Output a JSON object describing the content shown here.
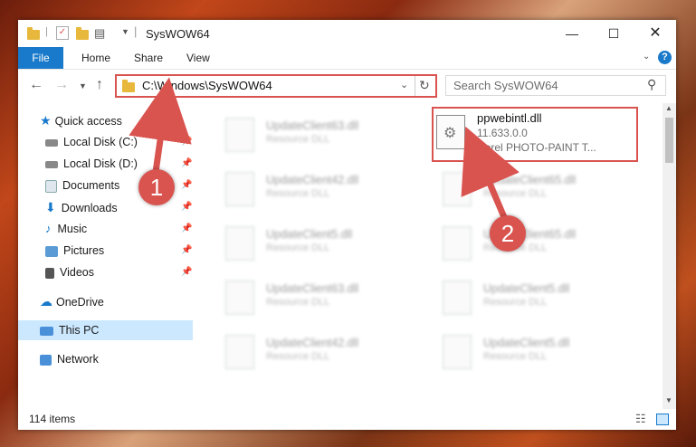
{
  "window": {
    "title": "SysWOW64"
  },
  "ribbon": {
    "tabs": [
      "File",
      "Home",
      "Share",
      "View"
    ]
  },
  "address": {
    "path": "C:\\Windows\\SysWOW64"
  },
  "search": {
    "placeholder": "Search SysWOW64"
  },
  "sidebar": {
    "items": [
      {
        "label": "Quick access"
      },
      {
        "label": "Local Disk (C:)"
      },
      {
        "label": "Local Disk (D:)"
      },
      {
        "label": "Documents"
      },
      {
        "label": "Downloads"
      },
      {
        "label": "Music"
      },
      {
        "label": "Pictures"
      },
      {
        "label": "Videos"
      },
      {
        "label": "OneDrive"
      },
      {
        "label": "This PC"
      },
      {
        "label": "Network"
      }
    ]
  },
  "files": [
    {
      "name": "UpdateClient63.dll",
      "type": "Resource DLL"
    },
    {
      "name": "UpdateClient42.dll",
      "type": "Resource DLL"
    },
    {
      "name": "UpdateClient65.dll",
      "type": "Resource DLL"
    },
    {
      "name": "UpdateClient5.dll",
      "type": "Resource DLL"
    },
    {
      "name": "UpdateClient65.dll",
      "type": "Resource DLL"
    },
    {
      "name": "UpdateClient63.dll",
      "type": "Resource DLL"
    },
    {
      "name": "UpdateClient5.dll",
      "type": "Resource DLL"
    },
    {
      "name": "UpdateClient42.dll",
      "type": "Resource DLL"
    },
    {
      "name": "UpdateClient5.dll",
      "type": "Resource DLL"
    }
  ],
  "highlighted_file": {
    "name": "ppwebintl.dll",
    "version": "11.633.0.0",
    "description": "Corel PHOTO-PAINT T..."
  },
  "status": {
    "count": "114 items"
  },
  "annotations": {
    "step1": "1",
    "step2": "2"
  },
  "colors": {
    "accent": "#1979ca",
    "highlight": "#d9534f",
    "selection": "#cce8ff"
  }
}
